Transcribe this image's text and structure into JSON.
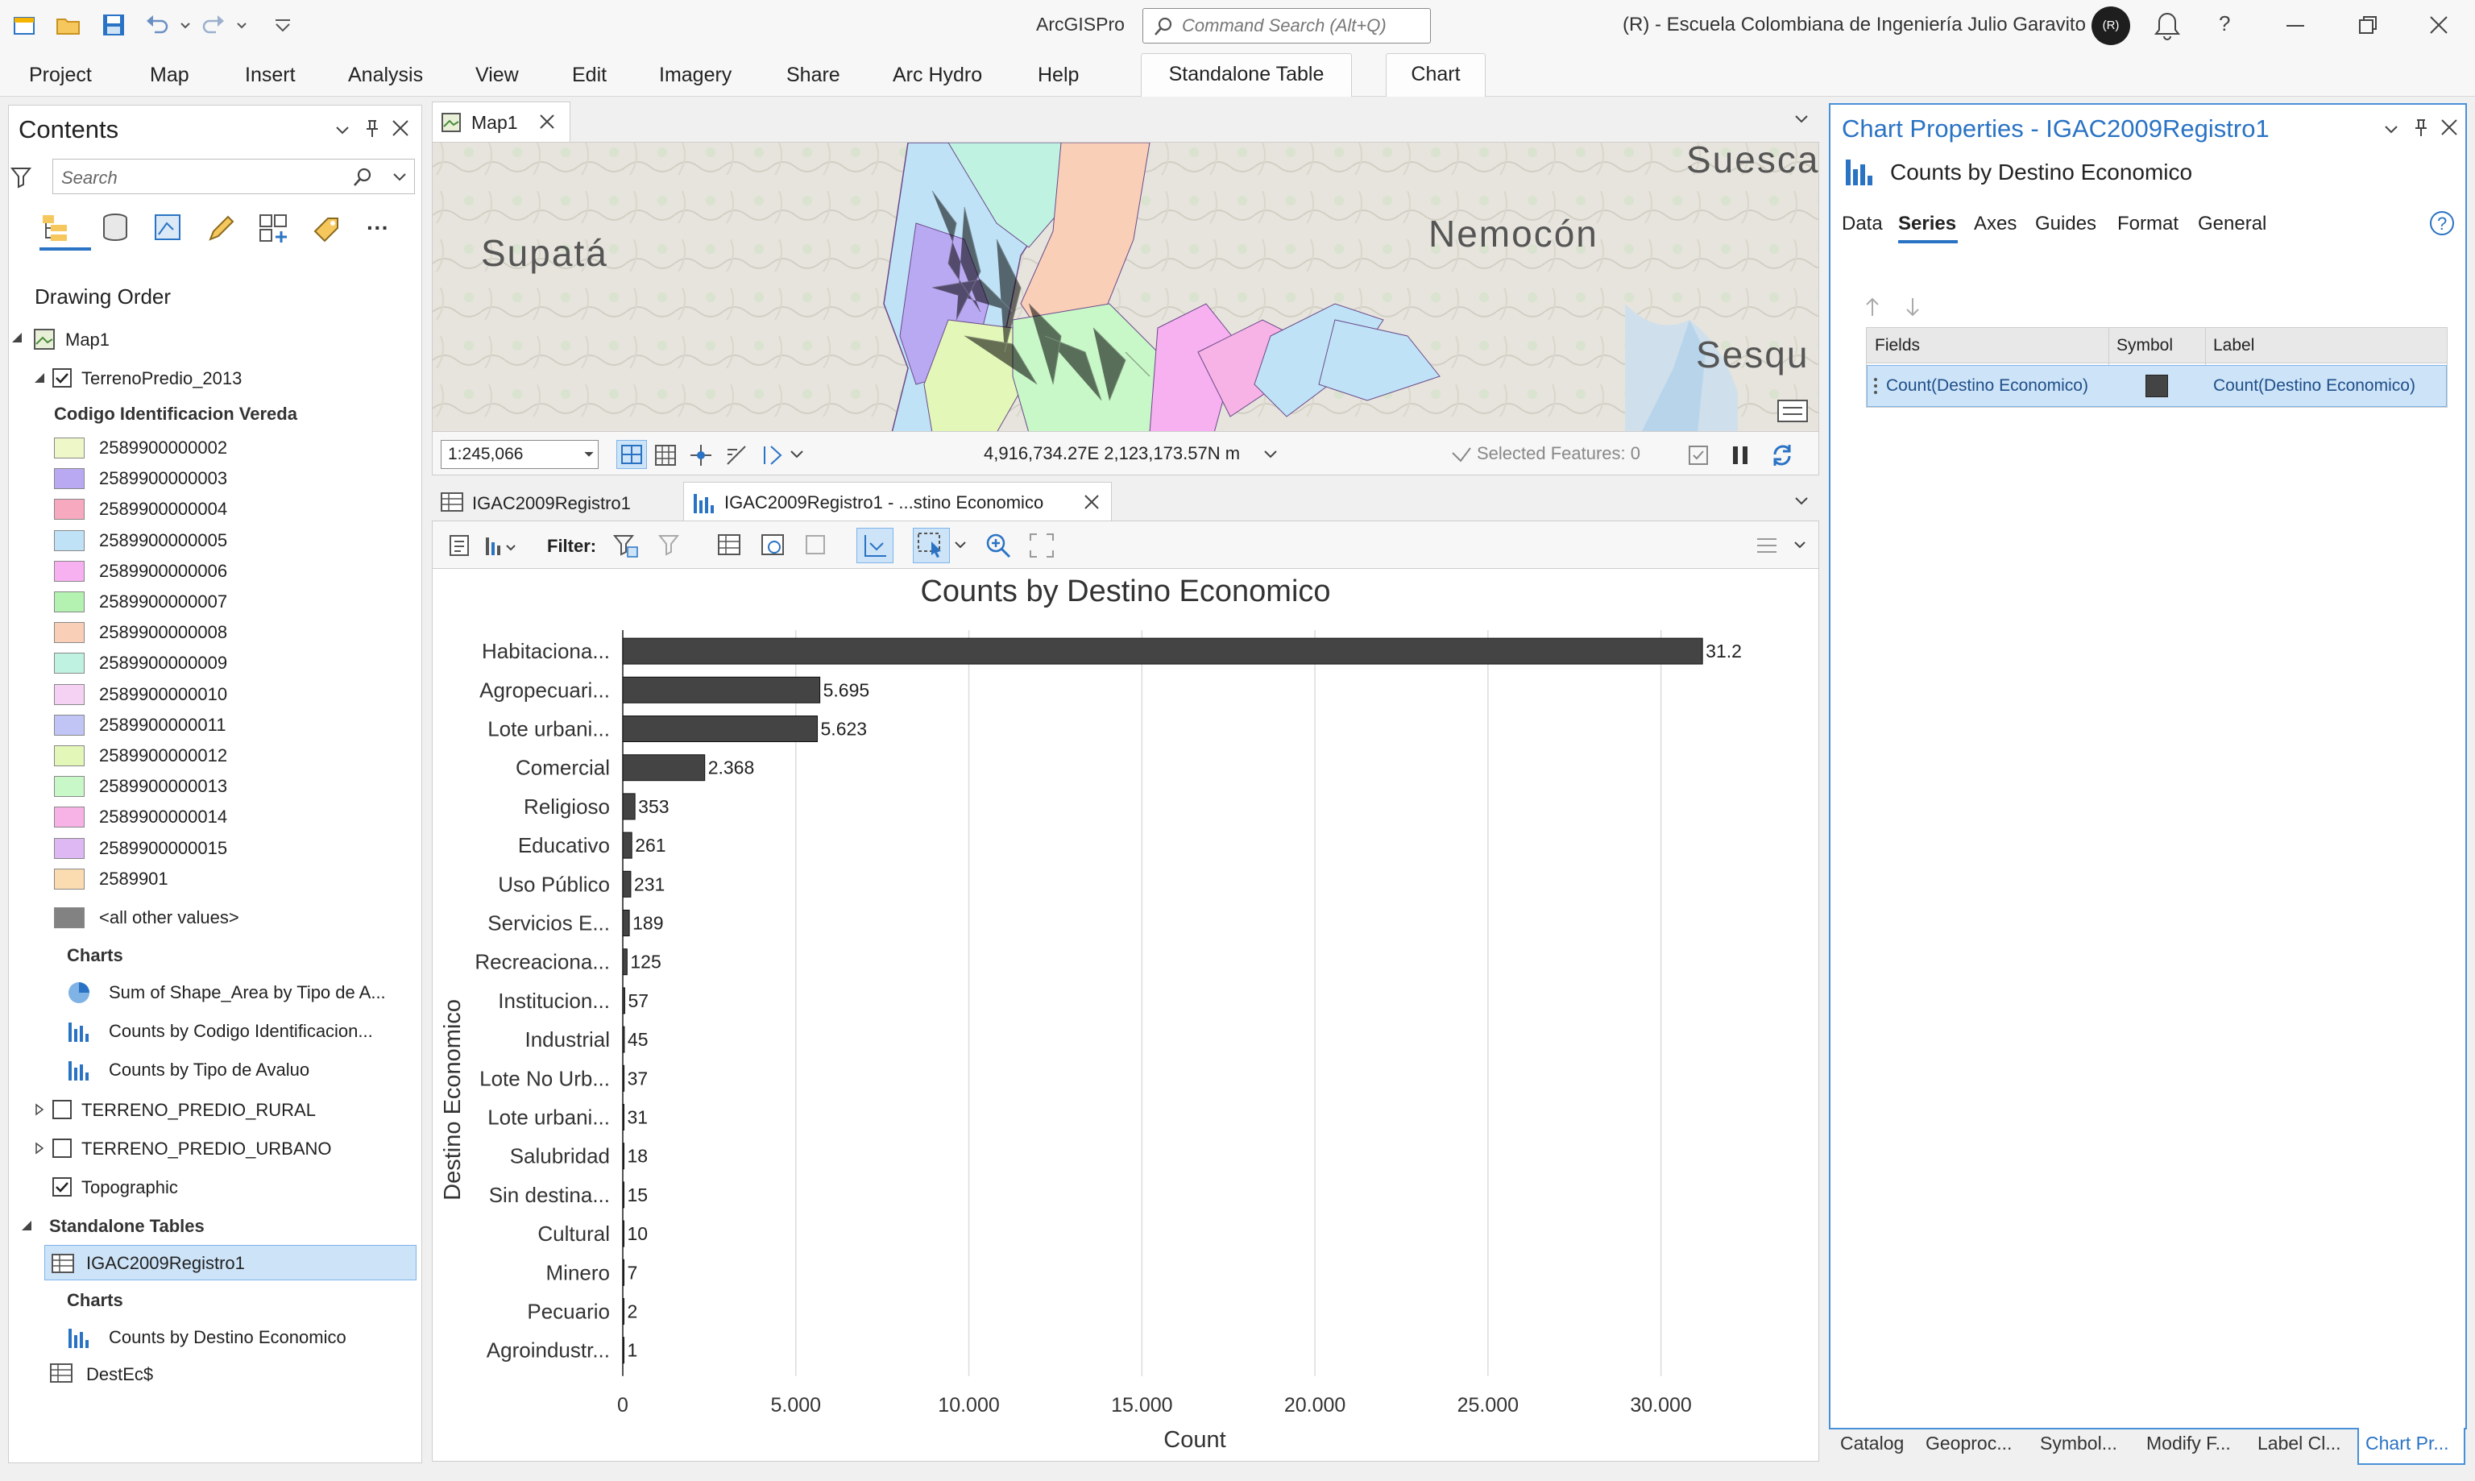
{
  "app": {
    "name": "ArcGISPro",
    "search_placeholder": "Command Search (Alt+Q)",
    "user_initials": "(R)",
    "org": "(R) - Escuela Colombiana de Ingeniería Julio Garavito",
    "help": "?"
  },
  "ribbon": {
    "tabs": [
      "Project",
      "Map",
      "Insert",
      "Analysis",
      "View",
      "Edit",
      "Imagery",
      "Share",
      "Arc Hydro",
      "Help"
    ],
    "context_tabs": [
      "Standalone Table",
      "Chart"
    ]
  },
  "contents": {
    "title": "Contents",
    "search_placeholder": "Search",
    "drawing_order": "Drawing Order",
    "map_name": "Map1",
    "layer_name": "TerrenoPredio_2013",
    "legend_title": "Codigo Identificacion Vereda",
    "legend": [
      {
        "label": "2589900000002",
        "color": "#eef7c8"
      },
      {
        "label": "2589900000003",
        "color": "#b9a9f2"
      },
      {
        "label": "2589900000004",
        "color": "#f7a9bf"
      },
      {
        "label": "2589900000005",
        "color": "#bfe2f7"
      },
      {
        "label": "2589900000006",
        "color": "#f7b0f0"
      },
      {
        "label": "2589900000007",
        "color": "#b3f2b0"
      },
      {
        "label": "2589900000008",
        "color": "#f9cfb8"
      },
      {
        "label": "2589900000009",
        "color": "#c0f2e2"
      },
      {
        "label": "2589900000010",
        "color": "#f5d2f3"
      },
      {
        "label": "2589900000011",
        "color": "#c0c5f5"
      },
      {
        "label": "2589900000012",
        "color": "#e2f7b8"
      },
      {
        "label": "2589900000013",
        "color": "#c8f7c8"
      },
      {
        "label": "2589900000014",
        "color": "#f7b3e6"
      },
      {
        "label": "2589900000015",
        "color": "#ddb8f2"
      },
      {
        "label": "2589901",
        "color": "#fbdcb0"
      },
      {
        "label": "<all other values>",
        "color": "#828282"
      }
    ],
    "charts_header": "Charts",
    "layer_charts": [
      {
        "label": "Sum of Shape_Area by Tipo de A...",
        "icon": "pie-chart-icon"
      },
      {
        "label": "Counts by Codigo Identificacion...",
        "icon": "bar-chart-icon"
      },
      {
        "label": "Counts by Tipo de Avaluo",
        "icon": "bar-chart-icon"
      }
    ],
    "other_layers": [
      "TERRENO_PREDIO_RURAL",
      "TERRENO_PREDIO_URBANO",
      "Topographic"
    ],
    "standalone_header": "Standalone Tables",
    "table_name": "IGAC2009Registro1",
    "table_charts_header": "Charts",
    "table_chart": "Counts by Destino Economico",
    "other_table": "DestEc$"
  },
  "map": {
    "tab": "Map1",
    "scale": "1:245,066",
    "coords": "4,916,734.27E 2,123,173.57N m",
    "selected": "Selected Features: 0",
    "places": [
      "Supatá",
      "Nemocón",
      "Suesca",
      "Sesqu"
    ]
  },
  "chart_tabs": [
    "IGAC2009Registro1",
    "IGAC2009Registro1 - ...stino Economico"
  ],
  "chart_toolbar": {
    "filter_label": "Filter:"
  },
  "chart_data": {
    "type": "bar",
    "orientation": "horizontal",
    "title": "Counts by Destino Economico",
    "xlabel": "Count",
    "ylabel": "Destino Economico",
    "xlim": [
      0,
      32500
    ],
    "xticks": [
      0,
      5000,
      10000,
      15000,
      20000,
      25000,
      30000
    ],
    "xtick_labels": [
      "0",
      "5.000",
      "10.000",
      "15.000",
      "20.000",
      "25.000",
      "30.000"
    ],
    "bar_color": "#444444",
    "categories": [
      "Habitaciona...",
      "Agropecuari...",
      "Lote urbani...",
      "Comercial",
      "Religioso",
      "Educativo",
      "Uso Público",
      "Servicios E...",
      "Recreaciona...",
      "Institucion...",
      "Industrial",
      "Lote No Urb...",
      "Lote urbani...",
      "Salubridad",
      "Sin destina...",
      "Cultural",
      "Minero",
      "Pecuario",
      "Agroindustr..."
    ],
    "values": [
      31200,
      5695,
      5623,
      2368,
      353,
      261,
      231,
      189,
      125,
      57,
      45,
      37,
      31,
      18,
      15,
      10,
      7,
      2,
      1
    ],
    "value_labels": [
      "31.2",
      "5.695",
      "5.623",
      "2.368",
      "353",
      "261",
      "231",
      "189",
      "125",
      "57",
      "45",
      "37",
      "31",
      "18",
      "15",
      "10",
      "7",
      "2",
      "1"
    ]
  },
  "chart_properties": {
    "title": "Chart Properties - IGAC2009Registro1",
    "chart_name": "Counts by Destino Economico",
    "tabs": [
      "Data",
      "Series",
      "Axes",
      "Guides",
      "Format",
      "General"
    ],
    "active_tab": "Series",
    "columns": [
      "Fields",
      "Symbol",
      "Label"
    ],
    "row": {
      "field": "Count(Destino Economico)",
      "label": "Count(Destino Economico)",
      "symbol_color": "#444444"
    }
  },
  "bottom_tabs": [
    "Catalog",
    "Geoproc...",
    "Symbol...",
    "Modify F...",
    "Label Cl...",
    "Chart Pr..."
  ]
}
